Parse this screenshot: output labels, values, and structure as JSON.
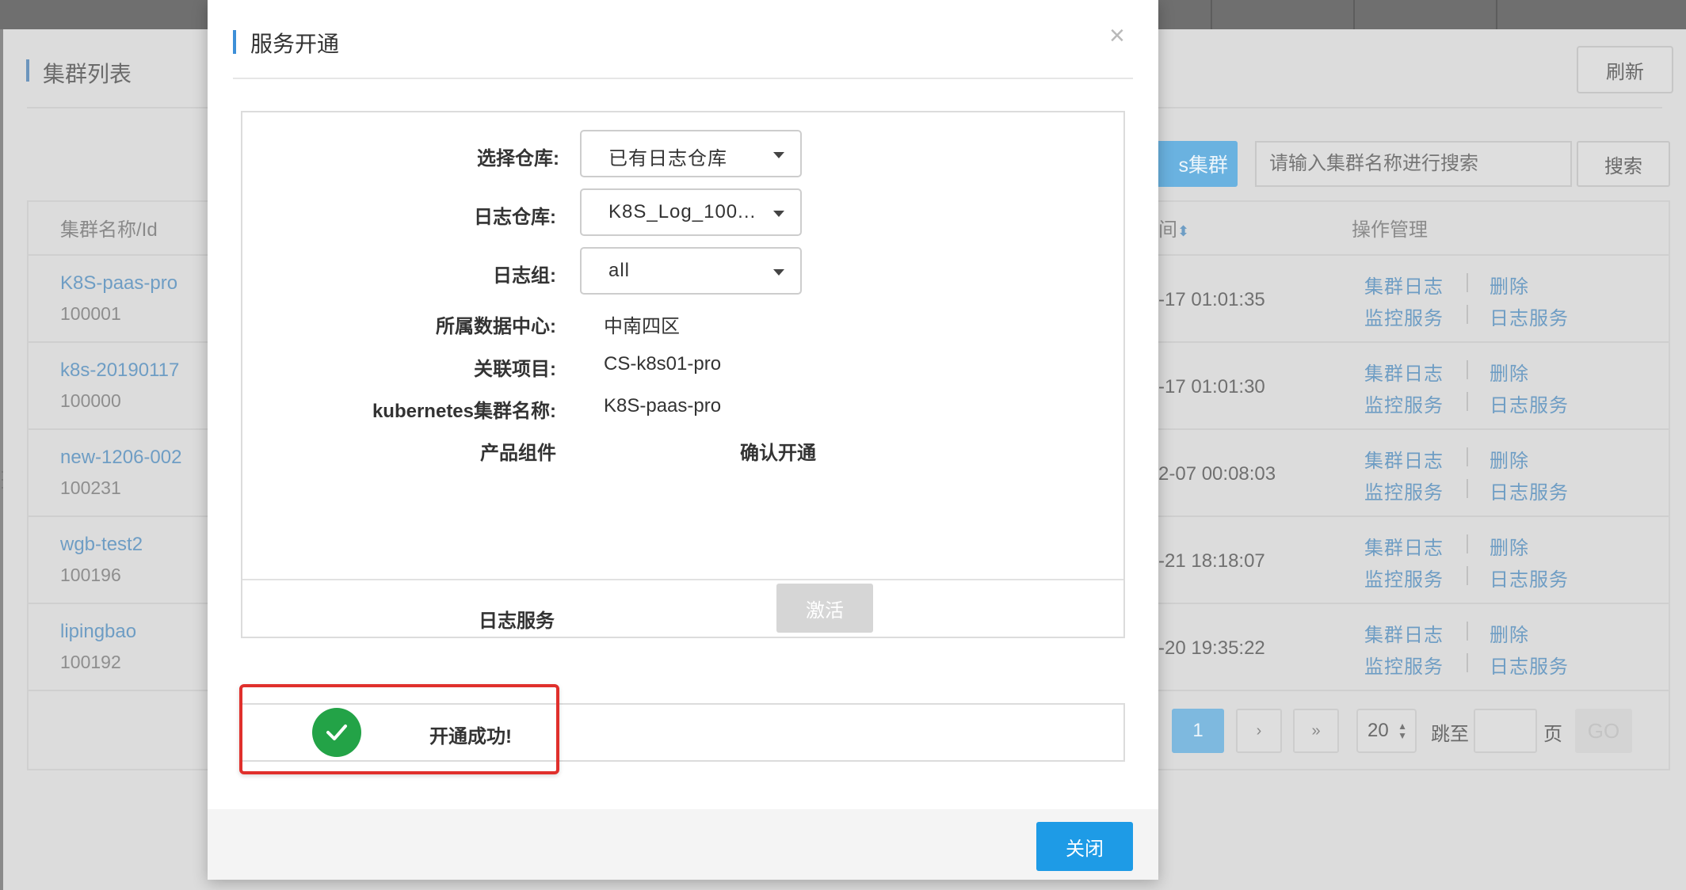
{
  "background": {
    "page_title": "集群列表",
    "refresh_label": "刷新",
    "add_cluster_label": "s集群",
    "search": {
      "placeholder": "请输入集群名称进行搜索",
      "button_label": "搜索"
    },
    "table": {
      "col_name": "集群名称/Id",
      "col_time": "间",
      "col_ops": "操作管理",
      "rows": [
        {
          "name": "K8S-paas-pro",
          "id": "100001",
          "time": "-17 01:01:35"
        },
        {
          "name": "k8s-20190117",
          "id": "100000",
          "time": "-17 01:01:30"
        },
        {
          "name": "new-1206-002",
          "id": "100231",
          "time": "2-07 00:08:03"
        },
        {
          "name": "wgb-test2",
          "id": "100196",
          "time": "-21 18:18:07"
        },
        {
          "name": "lipingbao",
          "id": "100192",
          "time": "-20 19:35:22"
        }
      ],
      "ops": {
        "cluster_log": "集群日志",
        "delete": "删除",
        "monitor": "监控服务",
        "log_service": "日志服务"
      }
    },
    "pagination": {
      "current": "1",
      "next": "›",
      "last": "»",
      "page_size": "20",
      "jump_label": "跳至",
      "page_unit": "页",
      "go_label": "GO"
    }
  },
  "modal": {
    "title": "服务开通",
    "close_icon": "×",
    "fields": {
      "repo_select_label": "选择仓库:",
      "repo_select_value": "已有日志仓库",
      "log_repo_label": "日志仓库:",
      "log_repo_value": "K8S_Log_100...",
      "log_group_label": "日志组:",
      "log_group_value": "all",
      "datacenter_label": "所属数据中心:",
      "datacenter_value": "中南四区",
      "project_label": "关联项目:",
      "project_value": "CS-k8s01-pro",
      "k8s_name_label": "kubernetes集群名称:",
      "k8s_name_value": "K8S-paas-pro",
      "component_header": "产品组件",
      "confirm_header": "确认开通",
      "service_label": "日志服务",
      "activate_label": "激活"
    },
    "status": {
      "text": "开通成功!",
      "color": "#23a347"
    },
    "footer": {
      "close_label": "关闭"
    }
  },
  "colors": {
    "primary": "#1e9be6",
    "highlight": "#e0302c",
    "link": "#6e9dc4"
  }
}
